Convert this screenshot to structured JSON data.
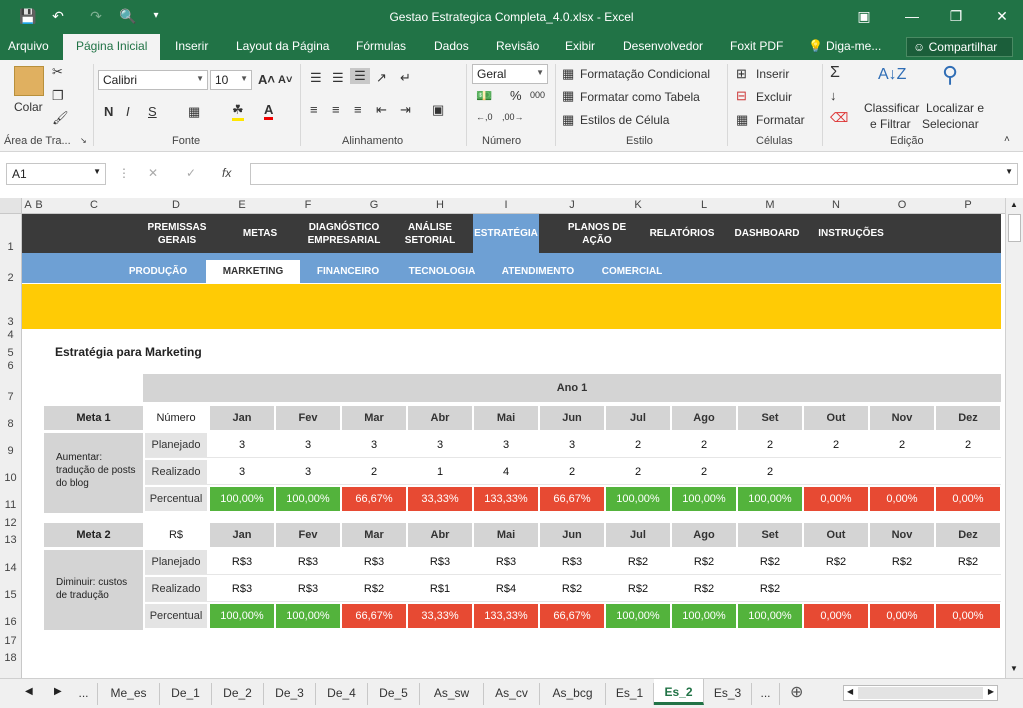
{
  "window": {
    "title": "Gestao Estrategica Completa_4.0.xlsx - Excel"
  },
  "ribbon_tabs": [
    "Arquivo",
    "Página Inicial",
    "Inserir",
    "Layout da Página",
    "Fórmulas",
    "Dados",
    "Revisão",
    "Exibir",
    "Desenvolvedor",
    "Foxit PDF",
    "Diga-me...",
    "Compartilhar"
  ],
  "ribbon": {
    "paste": "Colar",
    "clipboard": "Área de Tra...",
    "font_name": "Calibri",
    "font_size": "10",
    "font_group": "Fonte",
    "bold": "N",
    "italic": "I",
    "underline": "S",
    "align_group": "Alinhamento",
    "number_format": "Geral",
    "number_group": "Número",
    "cond_format": "Formatação Condicional",
    "format_table": "Formatar como Tabela",
    "cell_styles": "Estilos de Célula",
    "styles_group": "Estilo",
    "insert": "Inserir",
    "delete": "Excluir",
    "format": "Formatar",
    "cells_group": "Células",
    "sort1": "Classificar",
    "sort2": "e Filtrar",
    "find1": "Localizar e",
    "find2": "Selecionar",
    "edit_group": "Edição"
  },
  "formula_bar": {
    "name_box": "A1",
    "fx": "fx",
    "value": ""
  },
  "columns": [
    "A",
    "B",
    "C",
    "D",
    "E",
    "F",
    "G",
    "H",
    "I",
    "J",
    "K",
    "L",
    "M",
    "N",
    "O",
    "P"
  ],
  "rows": [
    "1",
    "2",
    "3",
    "4",
    "5",
    "6",
    "7",
    "8",
    "9",
    "10",
    "11",
    "12",
    "13",
    "14",
    "15",
    "16",
    "17",
    "18"
  ],
  "nav": [
    "PREMISSAS GERAIS",
    "METAS",
    "DIAGNÓSTICO EMPRESARIAL",
    "ANÁLISE SETORIAL",
    "ESTRATÉGIA",
    "PLANOS DE AÇÃO",
    "RELATÓRIOS",
    "DASHBOARD",
    "INSTRUÇÕES"
  ],
  "subnav": [
    "PRODUÇÃO",
    "MARKETING",
    "FINANCEIRO",
    "TECNOLOGIA",
    "ATENDIMENTO",
    "COMERCIAL"
  ],
  "heading": "Estratégia para Marketing",
  "year": "Ano 1",
  "months": [
    "Jan",
    "Fev",
    "Mar",
    "Abr",
    "Mai",
    "Jun",
    "Jul",
    "Ago",
    "Set",
    "Out",
    "Nov",
    "Dez"
  ],
  "meta1": {
    "title": "Meta 1",
    "unit": "Número",
    "desc": "Aumentar: tradução de posts do blog",
    "labels": [
      "Planejado",
      "Realizado",
      "Percentual"
    ],
    "planned": [
      "3",
      "3",
      "3",
      "3",
      "3",
      "3",
      "2",
      "2",
      "2",
      "2",
      "2",
      "2"
    ],
    "actual": [
      "3",
      "3",
      "2",
      "1",
      "4",
      "2",
      "2",
      "2",
      "2",
      "",
      "",
      ""
    ],
    "pct": [
      "100,00%",
      "100,00%",
      "66,67%",
      "33,33%",
      "133,33%",
      "66,67%",
      "100,00%",
      "100,00%",
      "100,00%",
      "0,00%",
      "0,00%",
      "0,00%"
    ],
    "status": [
      "g",
      "g",
      "r",
      "r",
      "r",
      "r",
      "g",
      "g",
      "g",
      "r",
      "r",
      "r"
    ]
  },
  "meta2": {
    "title": "Meta 2",
    "unit": "R$",
    "desc": "Diminuir: custos de tradução",
    "labels": [
      "Planejado",
      "Realizado",
      "Percentual"
    ],
    "planned": [
      "R$3",
      "R$3",
      "R$3",
      "R$3",
      "R$3",
      "R$3",
      "R$2",
      "R$2",
      "R$2",
      "R$2",
      "R$2",
      "R$2"
    ],
    "actual": [
      "R$3",
      "R$3",
      "R$2",
      "R$1",
      "R$4",
      "R$2",
      "R$2",
      "R$2",
      "R$2",
      "",
      "",
      ""
    ],
    "pct": [
      "100,00%",
      "100,00%",
      "66,67%",
      "33,33%",
      "133,33%",
      "66,67%",
      "100,00%",
      "100,00%",
      "100,00%",
      "0,00%",
      "0,00%",
      "0,00%"
    ],
    "status": [
      "g",
      "g",
      "r",
      "r",
      "r",
      "r",
      "g",
      "g",
      "g",
      "r",
      "r",
      "r"
    ]
  },
  "sheets": [
    "...",
    "Me_es",
    "De_1",
    "De_2",
    "De_3",
    "De_4",
    "De_5",
    "As_sw",
    "As_cv",
    "As_bcg",
    "Es_1",
    "Es_2",
    "Es_3",
    "..."
  ],
  "active_sheet": "Es_2"
}
